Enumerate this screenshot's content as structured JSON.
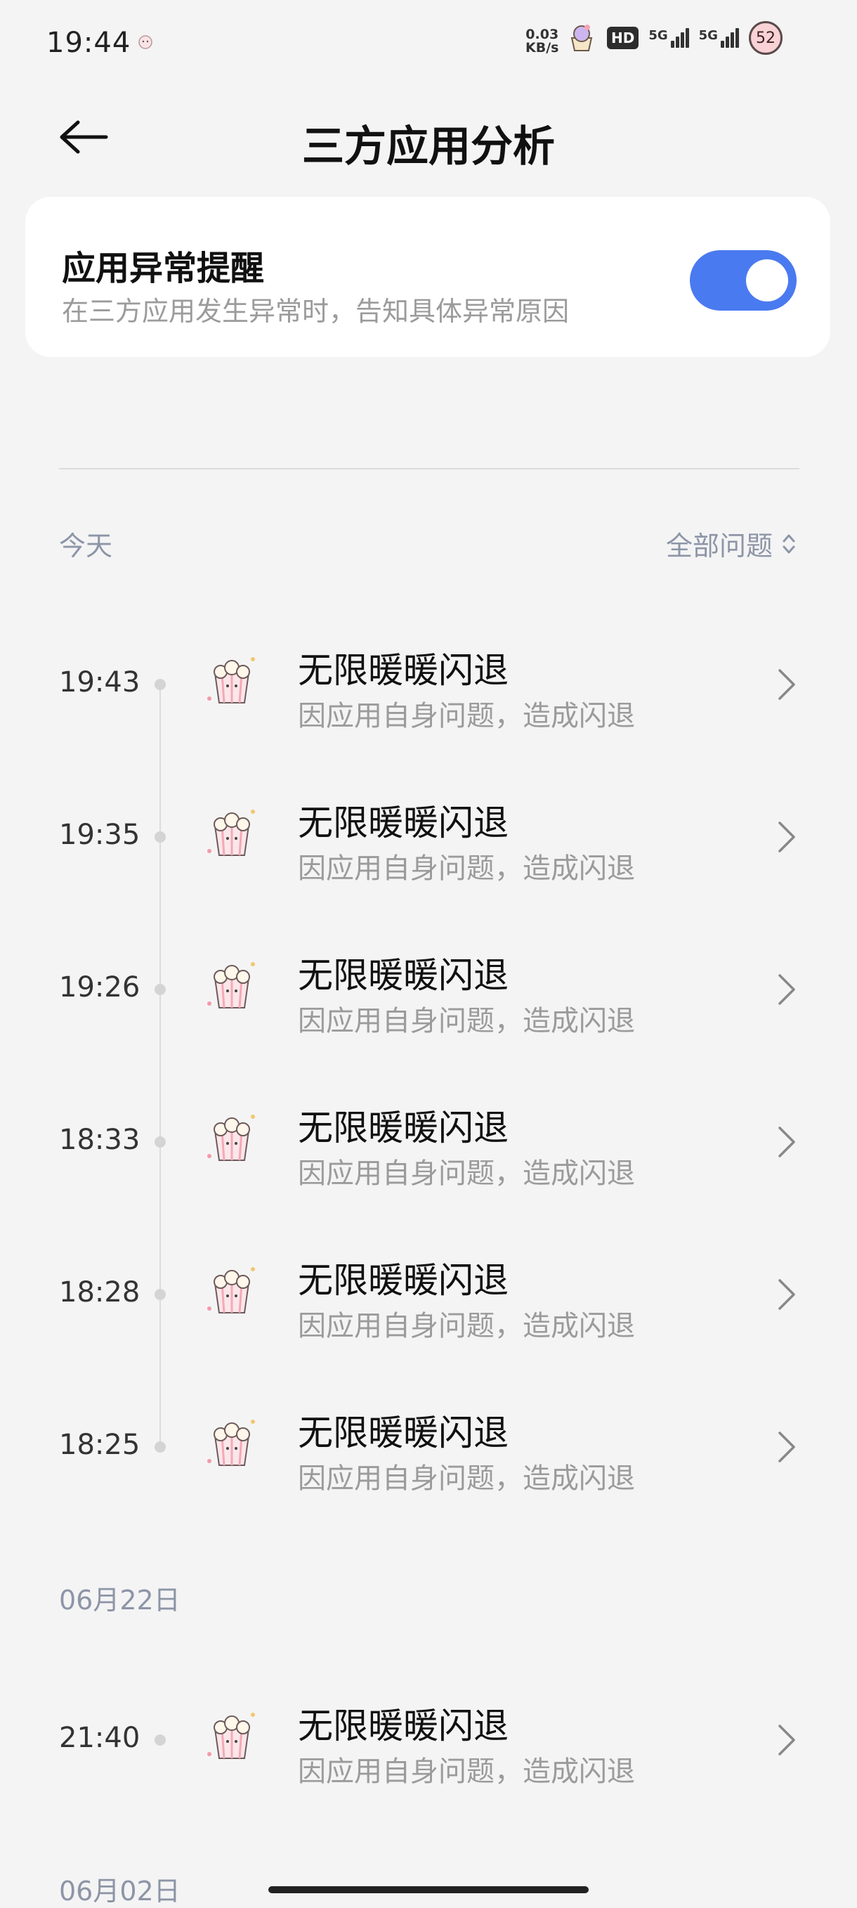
{
  "status_bar": {
    "time": "19:44",
    "net_speed_value": "0.03",
    "net_speed_unit": "KB/s",
    "hd_badge": "HD",
    "sim1_label": "5G",
    "sim2_label": "5G",
    "battery_level": "52"
  },
  "header": {
    "title": "三方应用分析",
    "back_icon": "arrow-left-icon"
  },
  "alert_card": {
    "title": "应用异常提醒",
    "subtitle": "在三方应用发生异常时，告知具体异常原因",
    "toggle_on": true,
    "accent_color": "#4a7af0"
  },
  "filter": {
    "label": "全部问题",
    "icon": "updown-chevron-icon"
  },
  "sections": [
    {
      "label": "今天",
      "items": [
        {
          "time": "19:43",
          "title": "无限暖暖闪退",
          "subtitle": "因应用自身问题，造成闪退"
        },
        {
          "time": "19:35",
          "title": "无限暖暖闪退",
          "subtitle": "因应用自身问题，造成闪退"
        },
        {
          "time": "19:26",
          "title": "无限暖暖闪退",
          "subtitle": "因应用自身问题，造成闪退"
        },
        {
          "time": "18:33",
          "title": "无限暖暖闪退",
          "subtitle": "因应用自身问题，造成闪退"
        },
        {
          "time": "18:28",
          "title": "无限暖暖闪退",
          "subtitle": "因应用自身问题，造成闪退"
        },
        {
          "time": "18:25",
          "title": "无限暖暖闪退",
          "subtitle": "因应用自身问题，造成闪退"
        }
      ]
    },
    {
      "label": "06月22日",
      "items": [
        {
          "time": "21:40",
          "title": "无限暖暖闪退",
          "subtitle": "因应用自身问题，造成闪退"
        }
      ]
    },
    {
      "label": "06月02日",
      "items": []
    }
  ]
}
